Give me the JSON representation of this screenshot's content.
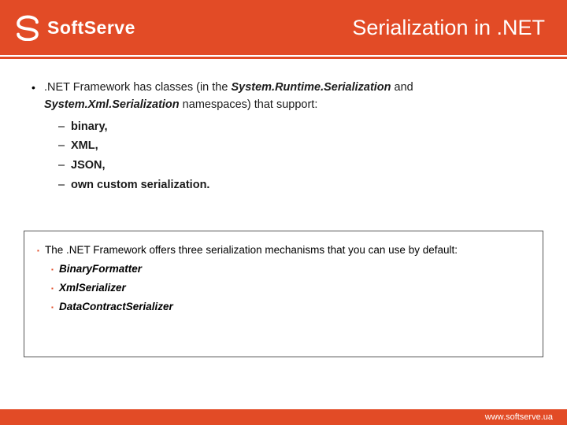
{
  "brand": {
    "name": "SoftServe"
  },
  "title": "Serialization in .NET",
  "bullets": {
    "intro_pre": ".NET Framework has classes (in the ",
    "ns1": "System.Runtime.Serialization",
    "intro_mid": " and ",
    "ns2": "System.Xml.Serialization",
    "intro_post": " namespaces) that support:",
    "items": [
      "binary,",
      "XML,",
      "JSON,",
      "own custom serialization."
    ]
  },
  "callout": {
    "lead": "The .NET Framework offers three serialization mechanisms that you can use by default:",
    "items": [
      "BinaryFormatter",
      "XmlSerializer",
      "DataContractSerializer"
    ]
  },
  "footer": {
    "url": "www.softserve.ua"
  }
}
